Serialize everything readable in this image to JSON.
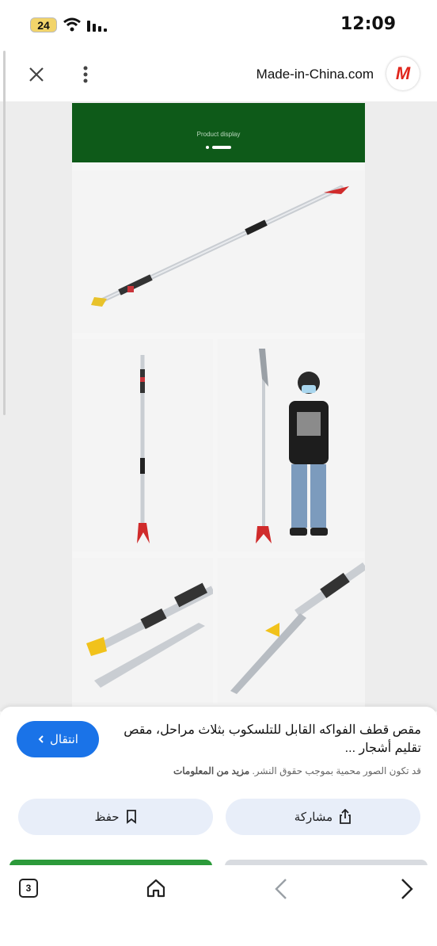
{
  "status_bar": {
    "battery": "24",
    "time": "12:09"
  },
  "browser": {
    "site_name": "Made-in-China.com",
    "logo_text": "M"
  },
  "preview": {
    "banner_text": "Product display"
  },
  "result": {
    "go_button_label": "انتقال",
    "title": "مقص قطف الفواكه القابل للتلسكوب بثلاث مراحل، مقص تقليم أشجار ...",
    "copyright_text": "قد تكون الصور محمية بموجب حقوق النشر.",
    "learn_more": "مزيد من المعلومات",
    "share_label": "مشاركة",
    "save_label": "حفظ"
  },
  "nav": {
    "tab_count": "3"
  },
  "colors": {
    "accent": "#1a73e8",
    "brand_red": "#e0261c",
    "banner_green": "#0e5a19",
    "pill_bg": "#e8eef9"
  },
  "icons": [
    "close-icon",
    "more-vert-icon",
    "wifi-icon",
    "signal-icon",
    "bookmark-icon",
    "share-icon",
    "home-icon",
    "back-arrow-icon",
    "forward-arrow-icon",
    "chevron-left-icon"
  ]
}
